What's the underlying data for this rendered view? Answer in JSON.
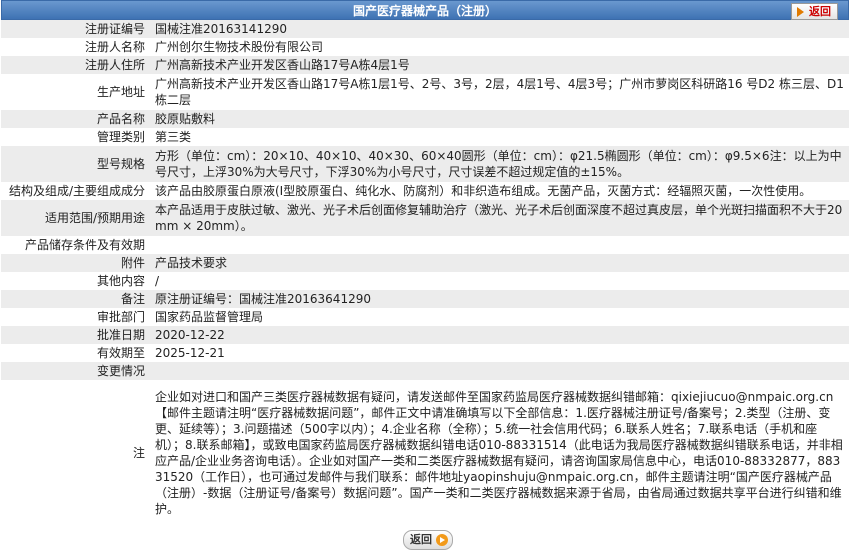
{
  "header": {
    "title": "国产医疗器械产品（注册）",
    "back_label": "返回"
  },
  "rows": [
    {
      "label": "注册证编号",
      "value": "国械注准20163141290"
    },
    {
      "label": "注册人名称",
      "value": "广州创尔生物技术股份有限公司"
    },
    {
      "label": "注册人住所",
      "value": "广州高新技术产业开发区香山路17号A栋4层1号"
    },
    {
      "label": "生产地址",
      "value": "广州高新技术产业开发区香山路17号A栋1层1号、2号、3号，2层，4层1号、4层3号；广州市萝岗区科研路16 号D2 栋三层、D1 栋二层"
    },
    {
      "label": "产品名称",
      "value": "胶原贴敷料"
    },
    {
      "label": "管理类别",
      "value": "第三类"
    },
    {
      "label": "型号规格",
      "value": "方形（单位：cm）：20×10、40×10、40×30、60×40圆形（单位：cm）：φ21.5椭圆形（单位：cm）：φ9.5×6注：以上为中号尺寸，上浮30%为大号尺寸，下浮30%为小号尺寸，尺寸误差不超过规定值的±15%。"
    },
    {
      "label": "结构及组成/主要组成成分",
      "value": "该产品由胶原蛋白原液(I型胶原蛋白、纯化水、防腐剂）和非织造布组成。无菌产品，灭菌方式：经辐照灭菌，一次性使用。"
    },
    {
      "label": "适用范围/预期用途",
      "value": "本产品适用于皮肤过敏、激光、光子术后创面修复辅助治疗（激光、光子术后创面深度不超过真皮层，单个光斑扫描面积不大于20mm × 20mm）。"
    },
    {
      "label": "产品储存条件及有效期",
      "value": ""
    },
    {
      "label": "附件",
      "value": "产品技术要求"
    },
    {
      "label": "其他内容",
      "value": "/"
    },
    {
      "label": "备注",
      "value": "原注册证编号：国械注准20163641290"
    },
    {
      "label": "审批部门",
      "value": "国家药品监督管理局"
    },
    {
      "label": "批准日期",
      "value": "2020-12-22"
    },
    {
      "label": "有效期至",
      "value": "2025-12-21"
    },
    {
      "label": "变更情况",
      "value": ""
    },
    {
      "label": "注",
      "value": "企业如对进口和国产三类医疗器械数据有疑问，请发送邮件至国家药监局医疗器械数据纠错邮箱：qixiejiucuo@nmpaic.org.cn【邮件主题请注明“医疗器械数据问题”，邮件正文中请准确填写以下全部信息：1.医疗器械注册证号/备案号；2.类型（注册、变更、延续等）；3.问题描述（500字以内）；4.企业名称（全称）；5.统一社会信用代码；6.联系人姓名；7.联系电话（手机和座机）；8.联系邮箱】，或致电国家药监局医疗器械数据纠错电话010-88331514（此电话为我局医疗器械数据纠错联系电话，并非相应产品/企业业务咨询电话）。企业如对国产一类和二类医疗器械数据有疑问，请咨询国家局信息中心，电话010-88332877，88331520（工作日），也可通过发邮件与我们联系：邮件地址yaopinshuju@nmpaic.org.cn，邮件主题请注明“国产医疗器械产品（注册）-数据（注册证号/备案号）数据问题”。国产一类和二类医疗器械数据来源于省局，由省局通过数据共享平台进行纠错和维护。"
    }
  ],
  "footer": {
    "back_label": "返回"
  },
  "colors": {
    "header_bg": "#4a7fc0",
    "row_alt": "#ececec"
  }
}
